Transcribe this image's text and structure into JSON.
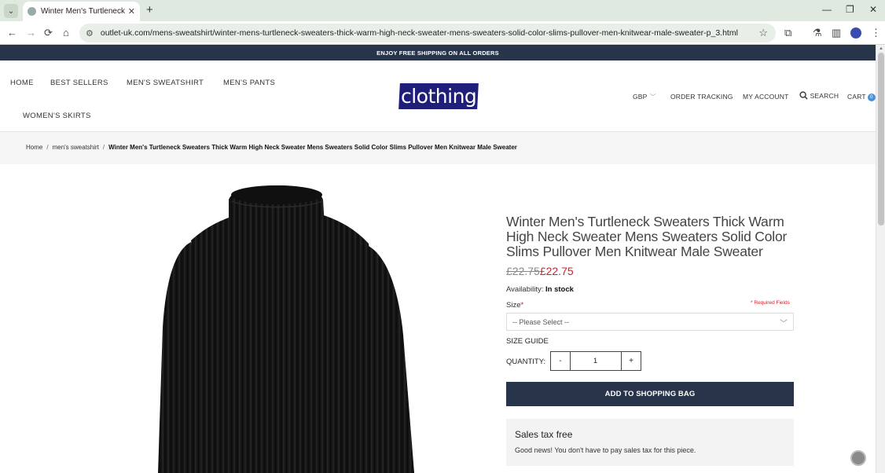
{
  "browser": {
    "tab_title": "Winter Men's Turtleneck Sweaters",
    "tab_close": "✕",
    "new_tab": "+",
    "url": "outlet-uk.com/mens-sweatshirt/winter-mens-turtleneck-sweaters-thick-warm-high-neck-sweater-mens-sweaters-solid-color-slims-pullover-men-knitwear-male-sweater-p_3.html",
    "icons": {
      "back": "arrow-left-icon",
      "forward": "arrow-right-icon",
      "reload": "reload-icon",
      "home": "home-icon",
      "bookmark": "star-icon",
      "extensions": "puzzle-icon",
      "menu": "kebab-menu-icon"
    }
  },
  "promo": {
    "text": "ENJOY FREE SHIPPING ON ALL ORDERS"
  },
  "nav": {
    "home": "HOME",
    "best_sellers": "BEST SELLERS",
    "mens_sweatshirt": "MEN'S SWEATSHIRT",
    "mens_pants": "MEN'S PANTS",
    "womens_skirts": "WOMEN'S SKIRTS"
  },
  "logo": {
    "text": "clothing"
  },
  "header_right": {
    "currency": "GBP",
    "order_tracking": "ORDER TRACKING",
    "my_account": "MY ACCOUNT",
    "search": "SEARCH",
    "cart": "CART",
    "cart_count": "0"
  },
  "breadcrumb": {
    "home": "Home",
    "category": "men's sweatshirt",
    "current": "Winter Men's Turtleneck Sweaters Thick Warm High Neck Sweater Mens Sweaters Solid Color Slims Pullover Men Knitwear Male Sweater"
  },
  "product": {
    "title": "Winter Men's Turtleneck Sweaters Thick Warm High Neck Sweater Mens Sweaters Solid Color Slims Pullover Men Knitwear Male Sweater",
    "old_price": "£22.75",
    "price": "£22.75",
    "availability_label": "Availability:",
    "availability_value": "In stock",
    "size_label": "Size",
    "required_marker": "*",
    "required_note": "* Required Fields",
    "size_placeholder": "-- Please Select --",
    "size_guide": "SIZE GUIDE",
    "quantity_label": "QUANTITY:",
    "quantity": "1",
    "minus": "-",
    "plus": "+",
    "add_button": "ADD TO SHOPPING BAG",
    "tax_title": "Sales tax free",
    "tax_text": "Good news! You don't have to pay sales tax for this piece.",
    "image_icon": "black-turtleneck-sweater-image"
  },
  "colors": {
    "navy": "#27344a",
    "sale_red": "#d0202a",
    "logo_blue": "#1f1f7a"
  }
}
